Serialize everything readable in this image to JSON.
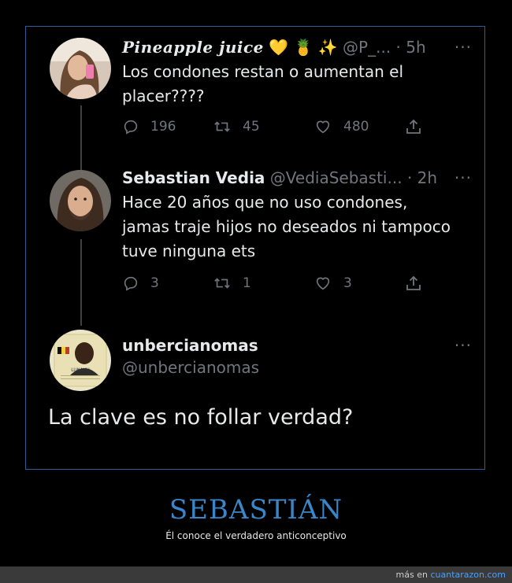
{
  "tweets": [
    {
      "name": "Pineapple juice",
      "emojis": "💛 🍍 ✨",
      "handle": "@P_...",
      "dot": "·",
      "time": "5h",
      "more": "···",
      "text": "Los condones restan o aumentan el placer????",
      "replies": "196",
      "retweets": "45",
      "likes": "480"
    },
    {
      "name": "Sebastian Vedia",
      "handle": "@VediaSebasti...",
      "dot": "·",
      "time": "2h",
      "more": "···",
      "text": "Hace 20 años que no uso condones, jamas traje hijos no deseados ni tampoco tuve ninguna ets",
      "replies": "3",
      "retweets": "1",
      "likes": "3"
    },
    {
      "name": "unbercianomas",
      "handle": "@unbercianomas",
      "more": "···",
      "text": "La clave es no follar verdad?",
      "card_name": "LUKAKU"
    }
  ],
  "caption": {
    "title": "SEBASTIÁN",
    "subtitle": "Él conoce el verdadero anticonceptivo"
  },
  "footer": {
    "prefix": "más en",
    "site": "cuantarazon.com"
  },
  "colors": {
    "accent": "#3b86c9",
    "frame_border": "#2f5d9a",
    "muted": "#71767b"
  }
}
